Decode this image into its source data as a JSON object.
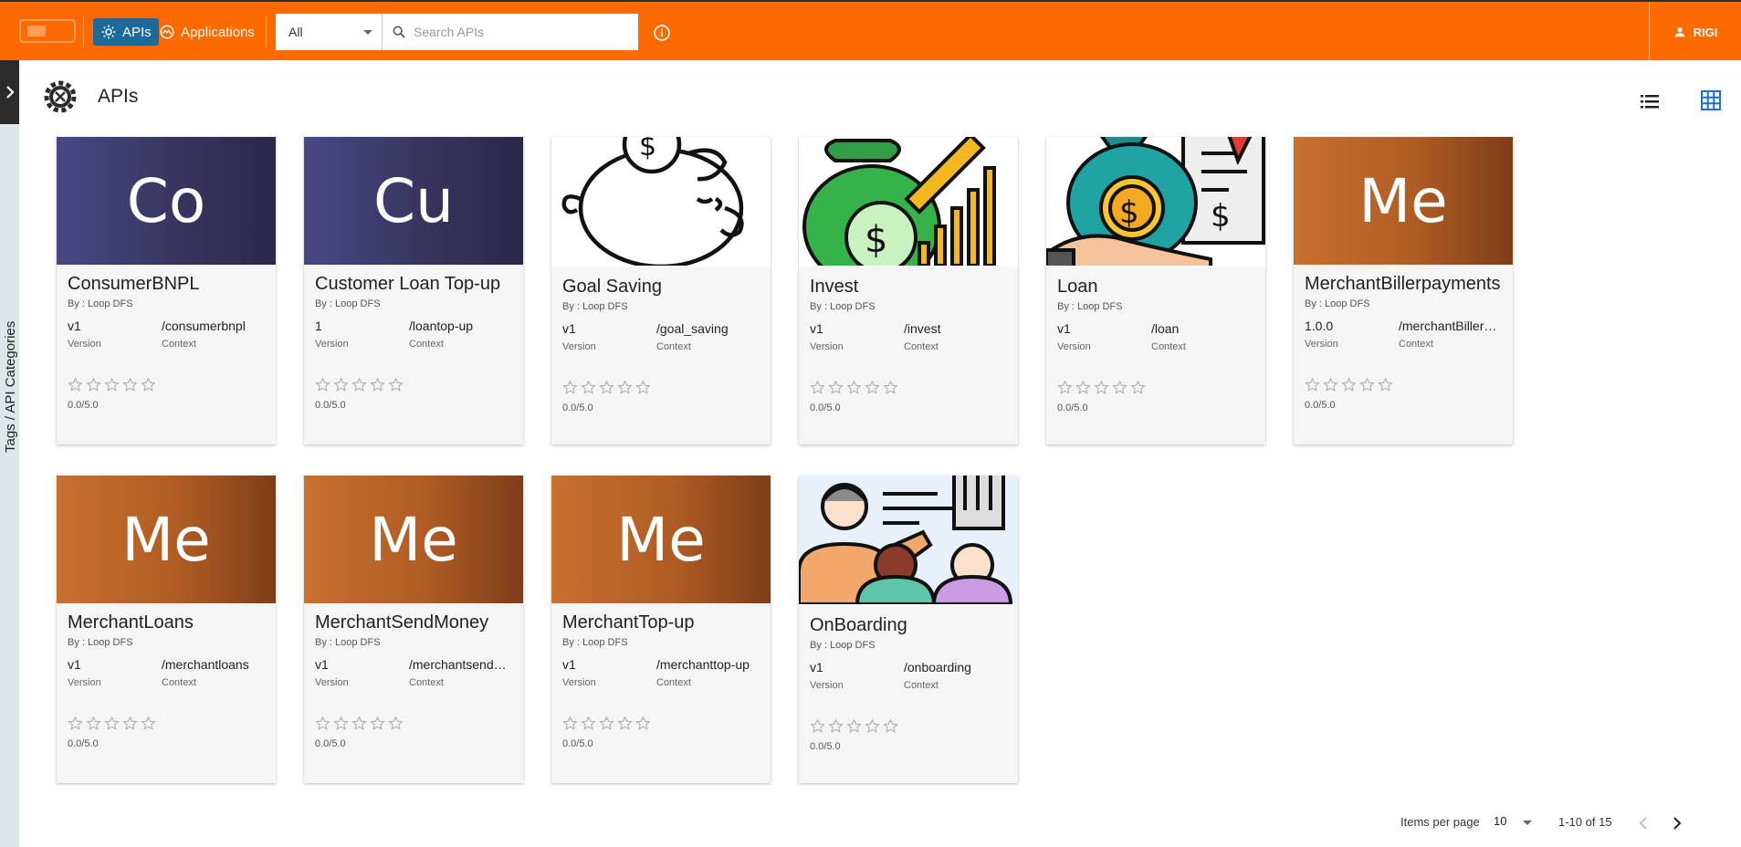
{
  "header": {
    "nav": [
      {
        "label": "APIs",
        "icon": "gear-icon",
        "active": true
      },
      {
        "label": "Applications",
        "icon": "applications-icon",
        "active": false
      }
    ],
    "filter": {
      "selected": "All"
    },
    "search": {
      "placeholder": "Search APIs",
      "value": ""
    },
    "user": {
      "name": "RIGI",
      "icon": "user-icon"
    },
    "accent_color": "#ff6a00"
  },
  "sidebar": {
    "label": "Tags / API Categories"
  },
  "page": {
    "title": "APIs"
  },
  "cards": [
    {
      "thumb_text": "Co",
      "thumb_style": "purple",
      "name": "ConsumerBNPL",
      "by": "By : Loop DFS",
      "version": "v1",
      "version_label": "Version",
      "context": "/consumerbnpl",
      "context_label": "Context",
      "rating": "0.0/5.0"
    },
    {
      "thumb_text": "Cu",
      "thumb_style": "purple",
      "name": "Customer Loan Top-up",
      "by": "By : Loop DFS",
      "version": "1",
      "version_label": "Version",
      "context": "/loantop-up",
      "context_label": "Context",
      "rating": "0.0/5.0"
    },
    {
      "thumb_text": "",
      "thumb_style": "pic",
      "thumb_icon": "piggy-bank-icon",
      "name": "Goal Saving",
      "by": "By : Loop DFS",
      "version": "v1",
      "version_label": "Version",
      "context": "/goal_saving",
      "context_label": "Context",
      "rating": "0.0/5.0"
    },
    {
      "thumb_text": "",
      "thumb_style": "pic",
      "thumb_icon": "money-bag-growth-icon",
      "name": "Invest",
      "by": "By : Loop DFS",
      "version": "v1",
      "version_label": "Version",
      "context": "/invest",
      "context_label": "Context",
      "rating": "0.0/5.0"
    },
    {
      "thumb_text": "",
      "thumb_style": "pic",
      "thumb_icon": "loan-bag-icon",
      "name": "Loan",
      "by": "By : Loop DFS",
      "version": "v1",
      "version_label": "Version",
      "context": "/loan",
      "context_label": "Context",
      "rating": "0.0/5.0"
    },
    {
      "thumb_text": "Me",
      "thumb_style": "orange",
      "name": "MerchantBillerpayments",
      "by": "By : Loop DFS",
      "version": "1.0.0",
      "version_label": "Version",
      "context": "/merchantBillerpayments",
      "context_label": "Context",
      "rating": "0.0/5.0"
    },
    {
      "thumb_text": "Me",
      "thumb_style": "orange",
      "name": "MerchantLoans",
      "by": "By : Loop DFS",
      "version": "v1",
      "version_label": "Version",
      "context": "/merchantloans",
      "context_label": "Context",
      "rating": "0.0/5.0"
    },
    {
      "thumb_text": "Me",
      "thumb_style": "orange",
      "name": "MerchantSendMoney",
      "by": "By : Loop DFS",
      "version": "v1",
      "version_label": "Version",
      "context": "/merchantsendmoney",
      "context_label": "Context",
      "rating": "0.0/5.0"
    },
    {
      "thumb_text": "Me",
      "thumb_style": "orange",
      "name": "MerchantTop-up",
      "by": "By : Loop DFS",
      "version": "v1",
      "version_label": "Version",
      "context": "/merchanttop-up",
      "context_label": "Context",
      "rating": "0.0/5.0"
    },
    {
      "thumb_text": "",
      "thumb_style": "pic",
      "thumb_icon": "onboarding-people-icon",
      "name": "OnBoarding",
      "by": "By : Loop DFS",
      "version": "v1",
      "version_label": "Version",
      "context": "/onboarding",
      "context_label": "Context",
      "rating": "0.0/5.0"
    }
  ],
  "pagination": {
    "items_per_page_label": "Items per page",
    "items_per_page": "10",
    "range": "1-10 of 15"
  }
}
